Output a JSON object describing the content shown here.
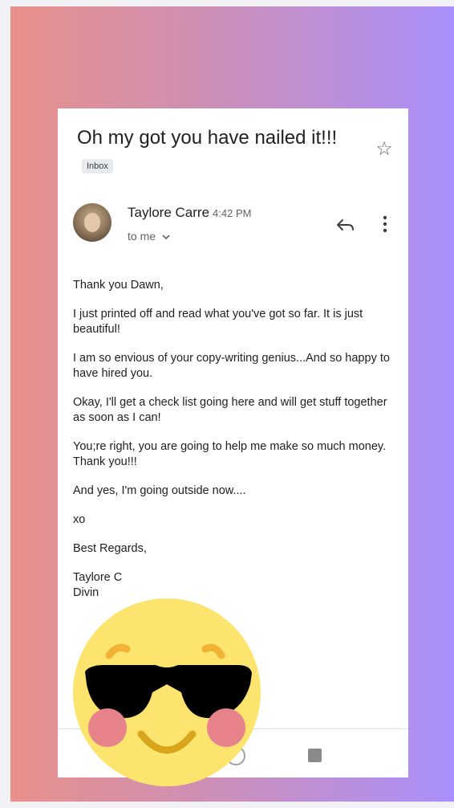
{
  "email": {
    "subject": "Oh my got you have nailed it!!!",
    "label": "Inbox",
    "sender": "Taylore Carre",
    "time": "4:42 PM",
    "recipient": "to me",
    "body": [
      "Thank you Dawn,",
      "I just printed off and read what you've got so far. It is just beautiful!",
      "I am so envious of your copy-writing genius...And so happy to have hired you.",
      "Okay, I'll get a check list going here and will get stuff together as soon as I can!",
      "You;re right, you are going to help me make so much money. Thank you!!!",
      "And yes, I'm going outside now....",
      "xo",
      "Best Regards,"
    ],
    "signature_line1": "Taylore C",
    "signature_line2": "Divin"
  },
  "icons": {
    "star": "star-outline-icon",
    "reply": "reply-icon",
    "more": "more-vert-icon",
    "dropdown": "chevron-down-icon",
    "emoji": "sunglasses-emoji"
  },
  "colors": {
    "gradient_start": "#e8908a",
    "gradient_end": "#a98ffc",
    "emoji_face": "#fde46f"
  }
}
